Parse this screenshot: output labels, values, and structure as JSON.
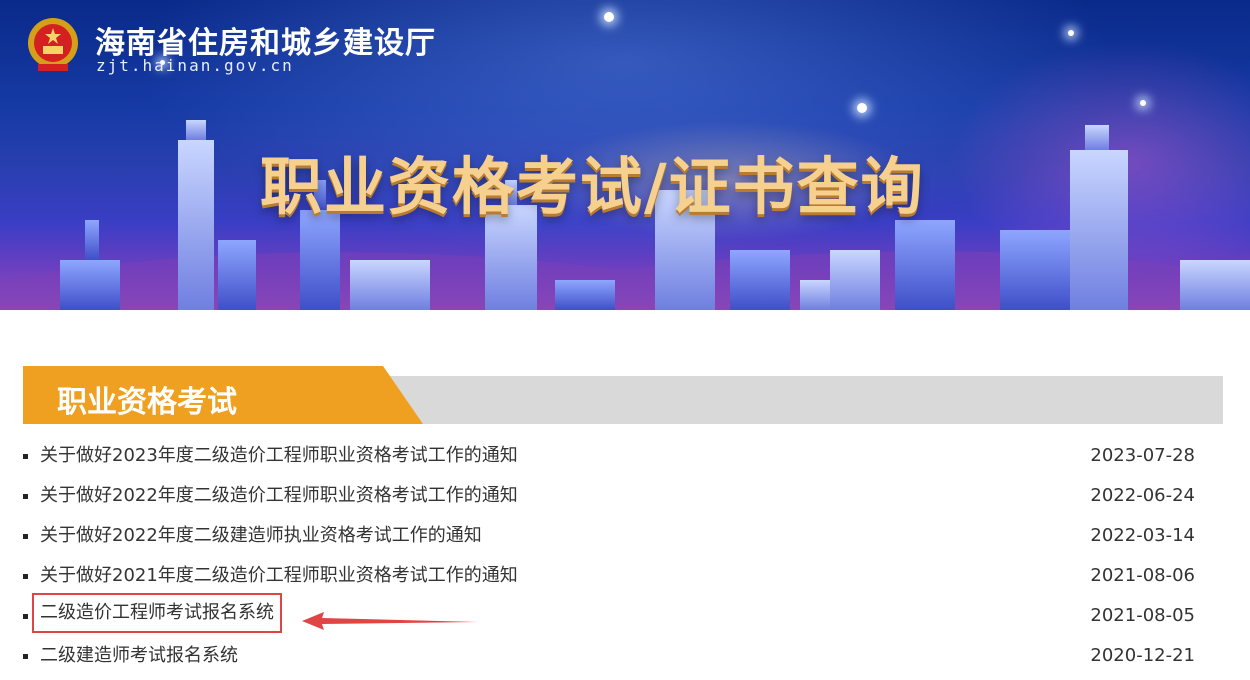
{
  "header": {
    "site_name": "海南省住房和城乡建设厅",
    "domain": "zjt.hainan.gov.cn",
    "banner_title": "职业资格考试/证书查询",
    "emblem_icon": "national-emblem-icon"
  },
  "section": {
    "title": "职业资格考试",
    "accent_color": "#f0a020",
    "bar_color": "#d9d9d9"
  },
  "notices": [
    {
      "title": "关于做好2023年度二级造价工程师职业资格考试工作的通知",
      "date": "2023-07-28"
    },
    {
      "title": "关于做好2022年度二级造价工程师职业资格考试工作的通知",
      "date": "2022-06-24"
    },
    {
      "title": "关于做好2022年度二级建造师执业资格考试工作的通知",
      "date": "2022-03-14"
    },
    {
      "title": "关于做好2021年度二级造价工程师职业资格考试工作的通知",
      "date": "2021-08-06"
    },
    {
      "title": "二级造价工程师考试报名系统",
      "date": "2021-08-05"
    },
    {
      "title": "二级建造师考试报名系统",
      "date": "2020-12-21"
    }
  ],
  "annotation": {
    "highlight_color": "#e04545"
  }
}
